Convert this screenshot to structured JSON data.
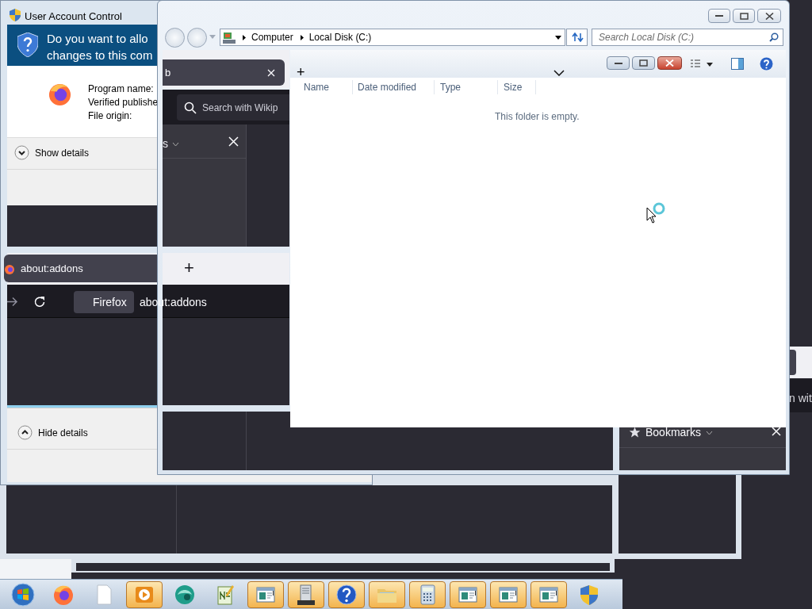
{
  "uac": {
    "title": "User Account Control",
    "question_lines": [
      "Do you want to allo",
      "changes to this com"
    ],
    "fields": [
      "Program name:",
      "Verified publishe",
      "File origin:"
    ],
    "show_details": "Show details",
    "hide_details": "Hide details"
  },
  "explorer": {
    "breadcrumb": [
      "Computer",
      "Local Disk (C:)"
    ],
    "search_placeholder": "Search Local Disk (C:)",
    "strip_new_tab": "+",
    "columns": [
      "Name",
      "Date modified",
      "Type",
      "Size"
    ],
    "empty_message": "This folder is empty."
  },
  "firefox_ghosts": {
    "top_tab": "b",
    "search_text": "Search with Wikip",
    "panel_title": "s",
    "new_tab": "+",
    "addons_tab": "about:addons",
    "identity_label": "Firefox",
    "url": "about:addons",
    "sidebar_title": "Bookmarks",
    "right_text": "n wit"
  },
  "taskbar": {
    "items": [
      {
        "kind": "start",
        "highlighted": false
      },
      {
        "kind": "firefox",
        "highlighted": false
      },
      {
        "kind": "document",
        "highlighted": false
      },
      {
        "kind": "media",
        "highlighted": true
      },
      {
        "kind": "orb",
        "highlighted": false
      },
      {
        "kind": "notepad",
        "highlighted": false
      },
      {
        "kind": "window",
        "highlighted": true
      },
      {
        "kind": "server",
        "highlighted": true
      },
      {
        "kind": "help",
        "highlighted": true
      },
      {
        "kind": "folder",
        "highlighted": true
      },
      {
        "kind": "calculator",
        "highlighted": true
      },
      {
        "kind": "window",
        "highlighted": true
      },
      {
        "kind": "window",
        "highlighted": true
      },
      {
        "kind": "window",
        "highlighted": true
      },
      {
        "kind": "shield",
        "highlighted": false
      }
    ]
  }
}
